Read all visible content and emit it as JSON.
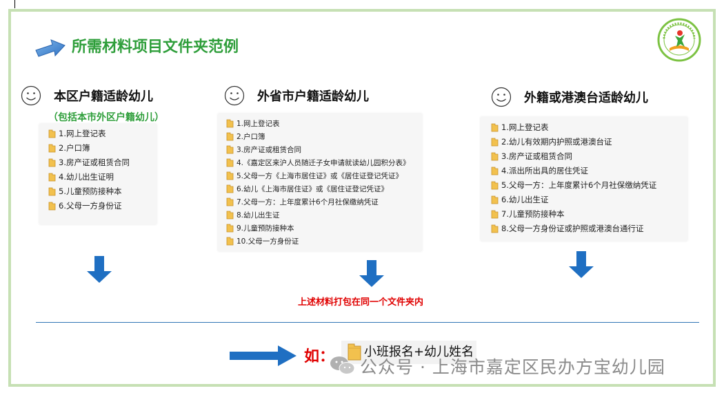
{
  "title": "所需材料项目文件夹范例",
  "colors": {
    "title_green": "#2e9e3a",
    "note_red": "#e00000",
    "arrow_blue": "#1f6fc2",
    "frame_green": "#c6e0b4"
  },
  "columns": [
    {
      "heading": "本区户籍适龄幼儿",
      "subheading": "（包括本市外区户籍幼儿）",
      "items": [
        "1.网上登记表",
        "2.户口簿",
        "3.房产证或租赁合同",
        "4.幼儿出生证明",
        "5.儿童预防接种本",
        "6.父母一方身份证"
      ]
    },
    {
      "heading": "外省市户籍适龄幼儿",
      "items": [
        "1.网上登记表",
        "2.户口簿",
        "3.房产证或租赁合同",
        "4.《嘉定区来沪人员随迁子女申请就读幼儿园积分表》",
        "5.父母一方《上海市居住证》或《居住证登记凭证》",
        "6.幼儿《上海市居住证》或《居住证登记凭证》",
        "7.父母一方：上年度累计6个月社保缴纳凭证",
        "8.幼儿出生证",
        "9.儿童预防接种本",
        "10.父母一方身份证"
      ]
    },
    {
      "heading": "外籍或港澳台适龄幼儿",
      "items": [
        "1.网上登记表",
        "2.幼儿有效期内护照或港澳台证",
        "3.房产证或租赁合同",
        "4.派出所出具的居住凭证",
        "5.父母一方：上年度累计6个月社保缴纳凭证",
        "6.幼儿出生证",
        "7.儿童预防接种本",
        "8.父母一方身份证或护照或港澳台通行证"
      ]
    }
  ],
  "note": "上述材料打包在同一个文件夹内",
  "example_prefix": "如：",
  "example_folder": "小班报名+幼儿姓名",
  "watermark": "公众号 · 上海市嘉定区民办方宝幼儿园",
  "logo_label": "上海市嘉定区民办方宝幼儿园"
}
